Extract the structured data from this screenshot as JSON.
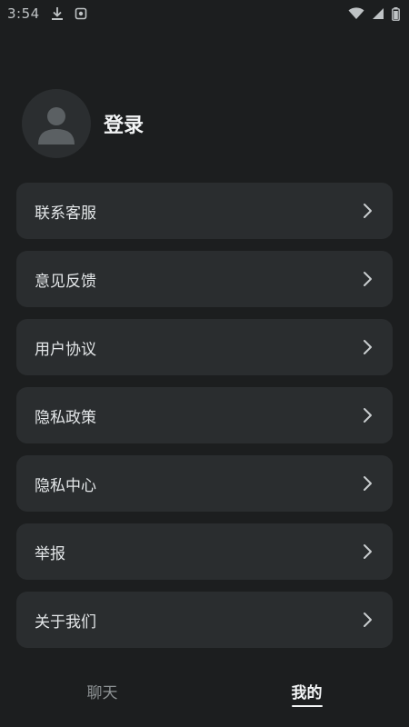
{
  "status_bar": {
    "time": "3:54",
    "icons": [
      "download-icon",
      "notification-icon",
      "wifi-icon",
      "signal-icon",
      "battery-icon"
    ]
  },
  "profile": {
    "login_label": "登录",
    "avatar_icon": "user-avatar-icon"
  },
  "menu": {
    "items": [
      {
        "label": "联系客服"
      },
      {
        "label": "意见反馈"
      },
      {
        "label": "用户协议"
      },
      {
        "label": "隐私政策"
      },
      {
        "label": "隐私中心"
      },
      {
        "label": "举报"
      },
      {
        "label": "关于我们"
      }
    ]
  },
  "tabs": {
    "chat": "聊天",
    "mine": "我的",
    "active": "mine"
  },
  "colors": {
    "background": "#1c1e1f",
    "card": "#2a2d2f",
    "text": "#e4e7e9",
    "inactive_tab": "#8f9496"
  }
}
